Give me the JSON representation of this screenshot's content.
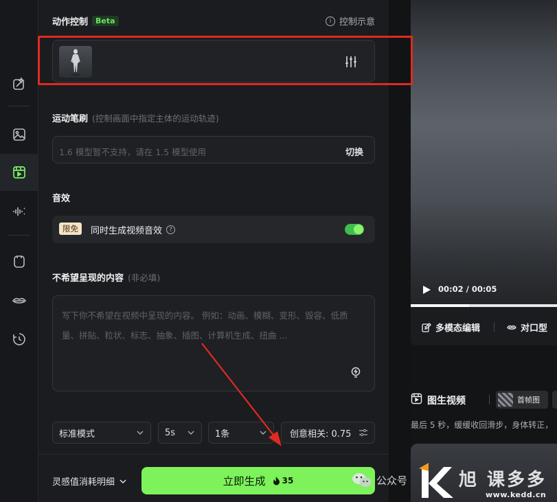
{
  "sidebar": {
    "items": [
      {
        "icon": "magic-wand-icon"
      },
      {
        "icon": "image-icon"
      },
      {
        "icon": "video-icon",
        "active": true
      },
      {
        "icon": "audio-wave-icon"
      },
      {
        "icon": "avatar-frame-icon"
      },
      {
        "icon": "lips-icon"
      },
      {
        "icon": "history-icon"
      }
    ]
  },
  "motion_control": {
    "title": "动作控制",
    "badge": "Beta",
    "hint": "控制示意"
  },
  "motion_brush": {
    "title": "运动笔刷",
    "subtitle": "(控制画面中指定主体的运动轨迹)",
    "placeholder": "1.6 模型暂不支持，请在 1.5 模型使用",
    "switch_label": "切换"
  },
  "sound": {
    "title": "音效",
    "badge": "限免",
    "label": "同时生成视频音效",
    "enabled": true
  },
  "negative": {
    "title": "不希望呈现的内容",
    "subtitle": "(非必填)",
    "placeholder": "写下你不希望在视频中呈现的内容。 例如：动画、模糊、变形、毁容、低质量、拼贴、粒状、标志、抽象、插图、计算机生成、扭曲 ..."
  },
  "options": {
    "mode": "标准模式",
    "duration": "5s",
    "count": "1条",
    "creativity": "创意相关: 0.75"
  },
  "footer": {
    "cost_label": "灵感值消耗明细",
    "generate_label": "立即生成",
    "generate_cost": "35"
  },
  "preview": {
    "time": "00:02 / 00:05",
    "progress": 0.4,
    "multimodal_edit": "多模态编辑",
    "lip_sync": "对口型"
  },
  "history_item": {
    "title": "图生视频",
    "frame_label": "首帧图",
    "prompt": "最后 5 秒，缓缓收回滑步，身体转正，"
  },
  "watermark": {
    "wechat": "公众号",
    "brand": "旭 课多多",
    "site": "www.kedd.cn"
  },
  "colors": {
    "accent": "#7df25b",
    "highlight": "#e02a20",
    "panel": "#1b1c1f"
  }
}
